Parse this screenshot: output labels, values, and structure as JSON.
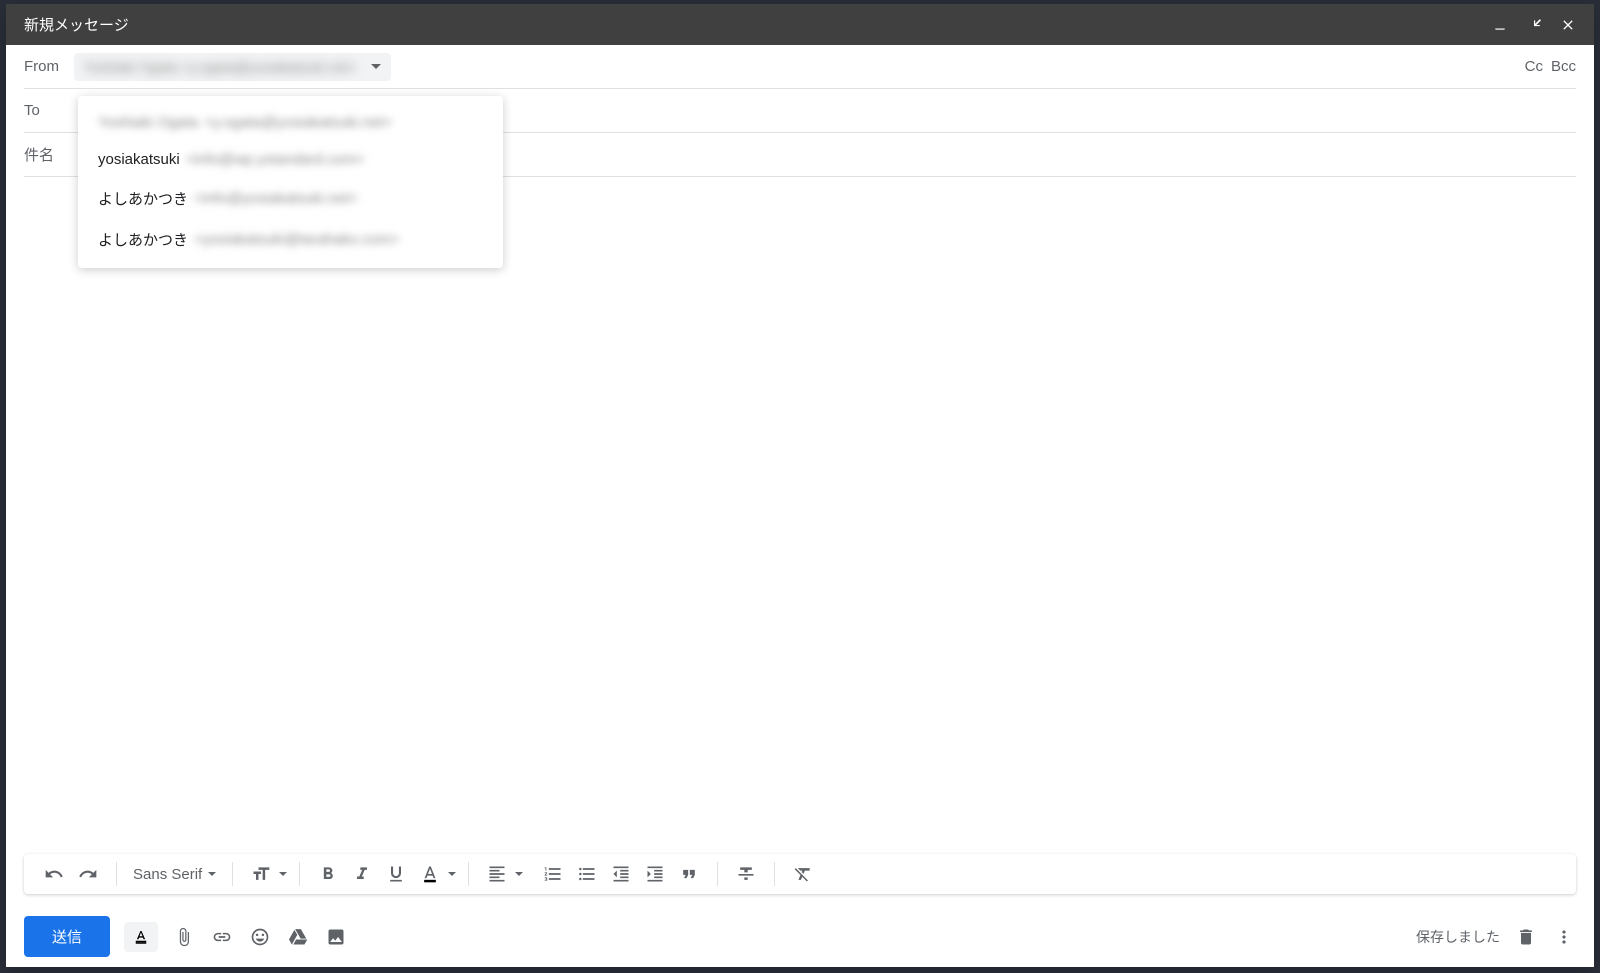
{
  "header": {
    "title": "新規メッセージ"
  },
  "fields": {
    "from_label": "From",
    "from_value": "Yoshiaki Ogata <y.ogata@yosiakatsuki.net>",
    "to_label": "To",
    "subject_label": "件名",
    "cc_label": "Cc",
    "bcc_label": "Bcc"
  },
  "dropdown": {
    "items": [
      {
        "name": "Yoshiaki Ogata",
        "email": "<y.ogata@yosiakatsuki.net>",
        "name_blurred": true
      },
      {
        "name": "yosiakatsuki",
        "email": "<info@wp.ystandard.com>",
        "name_blurred": false
      },
      {
        "name": "よしあかつき",
        "email": "<info@yosiakatsuki.net>",
        "name_blurred": false
      },
      {
        "name": "よしあかつき",
        "email": "<yosiakatsuki@tarahako.com>",
        "name_blurred": false
      }
    ]
  },
  "toolbar": {
    "font": "Sans Serif"
  },
  "bottom": {
    "send_label": "送信",
    "saved_label": "保存しました"
  }
}
